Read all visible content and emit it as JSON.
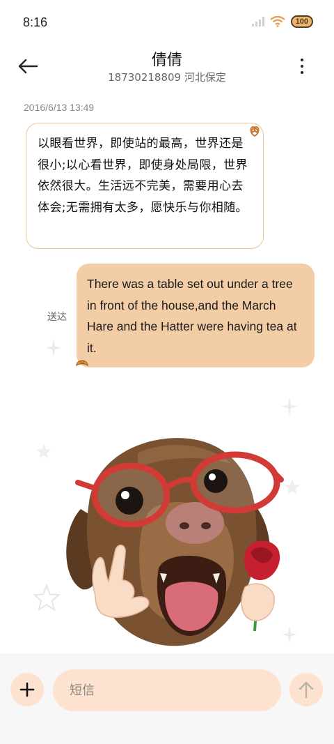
{
  "status_bar": {
    "time": "8:16",
    "battery_label": "100",
    "icons": [
      "signal-icon",
      "wifi-icon",
      "battery-icon"
    ]
  },
  "header": {
    "contact_name": "倩倩",
    "contact_detail": "18730218809 河北保定",
    "back_icon": "back-arrow-icon",
    "more_icon": "more-vert-icon"
  },
  "conversation": {
    "timestamp": "2016/6/13 13:49",
    "incoming": {
      "text": "以眼看世界，即使站的最高，世界还是很小;以心看世界，即使身处局限，世界依然很大。生活远不完美，需要用心去体会;无需拥有太多，愿快乐与你相随。",
      "decoration_icon": "pretzel-icon"
    },
    "outgoing": {
      "text": "There was a table set out under a tree in front of the house,and the March Hare and the Hatter were having tea at it.",
      "status": "送达",
      "decoration_icon": "croissant-icon"
    }
  },
  "sticker": {
    "description_icon": "dog-with-glasses-sticker"
  },
  "composer": {
    "placeholder": "短信",
    "add_icon": "plus-icon",
    "send_icon": "send-arrow-icon"
  },
  "colors": {
    "accent": "#fde3cf",
    "outgoing_bubble": "#f3cda5",
    "incoming_border": "#e8c39a"
  }
}
